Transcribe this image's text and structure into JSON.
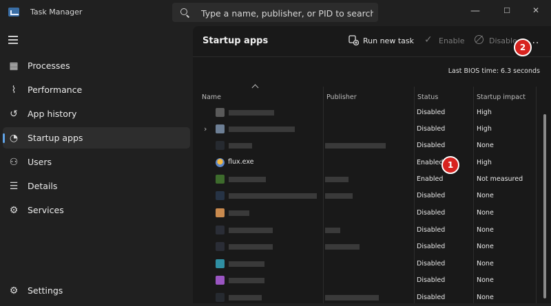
{
  "app": {
    "title": "Task Manager"
  },
  "search": {
    "placeholder": "Type a name, publisher, or PID to search"
  },
  "window_controls": {
    "minimize": "—",
    "maximize": "☐",
    "close": "✕"
  },
  "sidebar": {
    "items": [
      {
        "label": "Processes",
        "icon": "processes-icon"
      },
      {
        "label": "Performance",
        "icon": "performance-icon"
      },
      {
        "label": "App history",
        "icon": "history-icon"
      },
      {
        "label": "Startup apps",
        "icon": "startup-icon",
        "active": true
      },
      {
        "label": "Users",
        "icon": "users-icon"
      },
      {
        "label": "Details",
        "icon": "details-icon"
      },
      {
        "label": "Services",
        "icon": "services-icon"
      }
    ],
    "settings_label": "Settings"
  },
  "main": {
    "title": "Startup apps",
    "toolbar": {
      "run_new_task": "Run new task",
      "enable": "Enable",
      "disable": "Disable",
      "more": "···"
    },
    "bios_label": "Last BIOS time:  6.3 seconds",
    "columns": {
      "name": "Name",
      "publisher": "Publisher",
      "status": "Status",
      "impact": "Startup impact"
    },
    "rows": [
      {
        "name": "",
        "status": "Disabled",
        "impact": "High"
      },
      {
        "name": "",
        "status": "Disabled",
        "impact": "High"
      },
      {
        "name": "",
        "status": "Disabled",
        "impact": "None"
      },
      {
        "name": "flux.exe",
        "status": "Enabled",
        "impact": "High"
      },
      {
        "name": "",
        "status": "Enabled",
        "impact": "Not measured"
      },
      {
        "name": "",
        "status": "Disabled",
        "impact": "None"
      },
      {
        "name": "",
        "status": "Disabled",
        "impact": "None"
      },
      {
        "name": "",
        "status": "Disabled",
        "impact": "None"
      },
      {
        "name": "",
        "status": "Disabled",
        "impact": "None"
      },
      {
        "name": "",
        "status": "Disabled",
        "impact": "None"
      },
      {
        "name": "",
        "status": "Disabled",
        "impact": "None"
      },
      {
        "name": "",
        "status": "Disabled",
        "impact": "None"
      }
    ]
  },
  "annotations": {
    "badge_1": "1",
    "badge_2": "2"
  }
}
